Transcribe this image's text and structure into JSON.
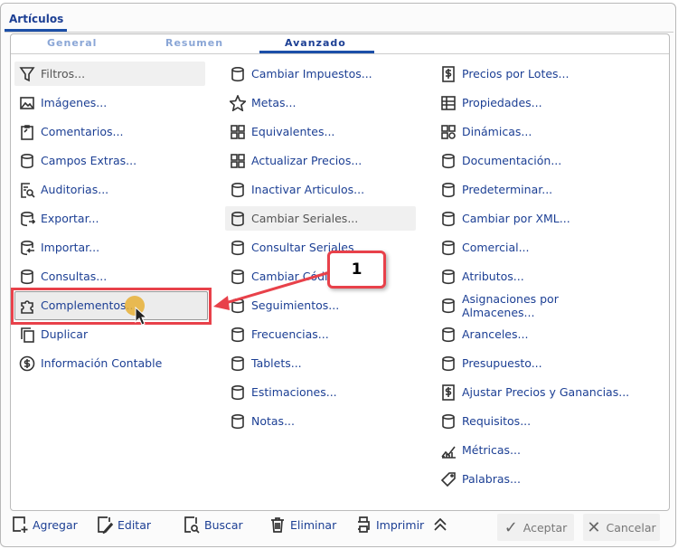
{
  "window": {
    "tab": "Artículos"
  },
  "subtabs": [
    "General",
    "Resumen",
    "Avanzado"
  ],
  "active_subtab": "Avanzado",
  "columns": [
    [
      {
        "label": "Filtros...",
        "icon": "filter",
        "disabled": true
      },
      {
        "label": "Imágenes...",
        "icon": "image"
      },
      {
        "label": "Comentarios...",
        "icon": "clipboard"
      },
      {
        "label": "Campos Extras...",
        "icon": "database"
      },
      {
        "label": "Auditorias...",
        "icon": "audit"
      },
      {
        "label": "Exportar...",
        "icon": "export"
      },
      {
        "label": "Importar...",
        "icon": "import"
      },
      {
        "label": "Consultas...",
        "icon": "database"
      },
      {
        "label": "Complementos...",
        "icon": "puzzle"
      },
      {
        "label": "Duplicar",
        "icon": "copy"
      },
      {
        "label": "Información Contable",
        "icon": "dollar-circle"
      }
    ],
    [
      {
        "label": "Cambiar Impuestos...",
        "icon": "database"
      },
      {
        "label": "Metas...",
        "icon": "star"
      },
      {
        "label": "Equivalentes...",
        "icon": "grid"
      },
      {
        "label": "Actualizar Precios...",
        "icon": "grid"
      },
      {
        "label": "Inactivar Articulos...",
        "icon": "database"
      },
      {
        "label": "Cambiar Seriales...",
        "icon": "database",
        "disabled": true
      },
      {
        "label": "Consultar Seriales",
        "icon": "database"
      },
      {
        "label": "Cambiar Códi",
        "icon": "database"
      },
      {
        "label": "Seguimientos...",
        "icon": "database"
      },
      {
        "label": "Frecuencias...",
        "icon": "database"
      },
      {
        "label": "Tablets...",
        "icon": "database"
      },
      {
        "label": "Estimaciones...",
        "icon": "database"
      },
      {
        "label": "Notas...",
        "icon": "database"
      }
    ],
    [
      {
        "label": "Precios por Lotes...",
        "icon": "dollar-square"
      },
      {
        "label": "Propiedades...",
        "icon": "list"
      },
      {
        "label": "Dinámicas...",
        "icon": "grid-gear"
      },
      {
        "label": "Documentación...",
        "icon": "database"
      },
      {
        "label": "Predeterminar...",
        "icon": "database"
      },
      {
        "label": "Cambiar por XML...",
        "icon": "database"
      },
      {
        "label": "Comercial...",
        "icon": "database"
      },
      {
        "label": "Atributos...",
        "icon": "database"
      },
      {
        "label": "Asignaciones por Almacenes...",
        "icon": "database"
      },
      {
        "label": "Aranceles...",
        "icon": "database"
      },
      {
        "label": "Presupuesto...",
        "icon": "database"
      },
      {
        "label": "Ajustar Precios y Ganancias...",
        "icon": "dollar-square"
      },
      {
        "label": "Requisitos...",
        "icon": "database"
      },
      {
        "label": "Métricas...",
        "icon": "chart"
      },
      {
        "label": "Palabras...",
        "icon": "tag"
      }
    ]
  ],
  "callout": {
    "label": "1"
  },
  "footer": {
    "add": "Agregar",
    "edit": "Editar",
    "search": "Buscar",
    "delete": "Eliminar",
    "print": "Imprimir",
    "accept": "Aceptar",
    "cancel": "Cancelar"
  }
}
